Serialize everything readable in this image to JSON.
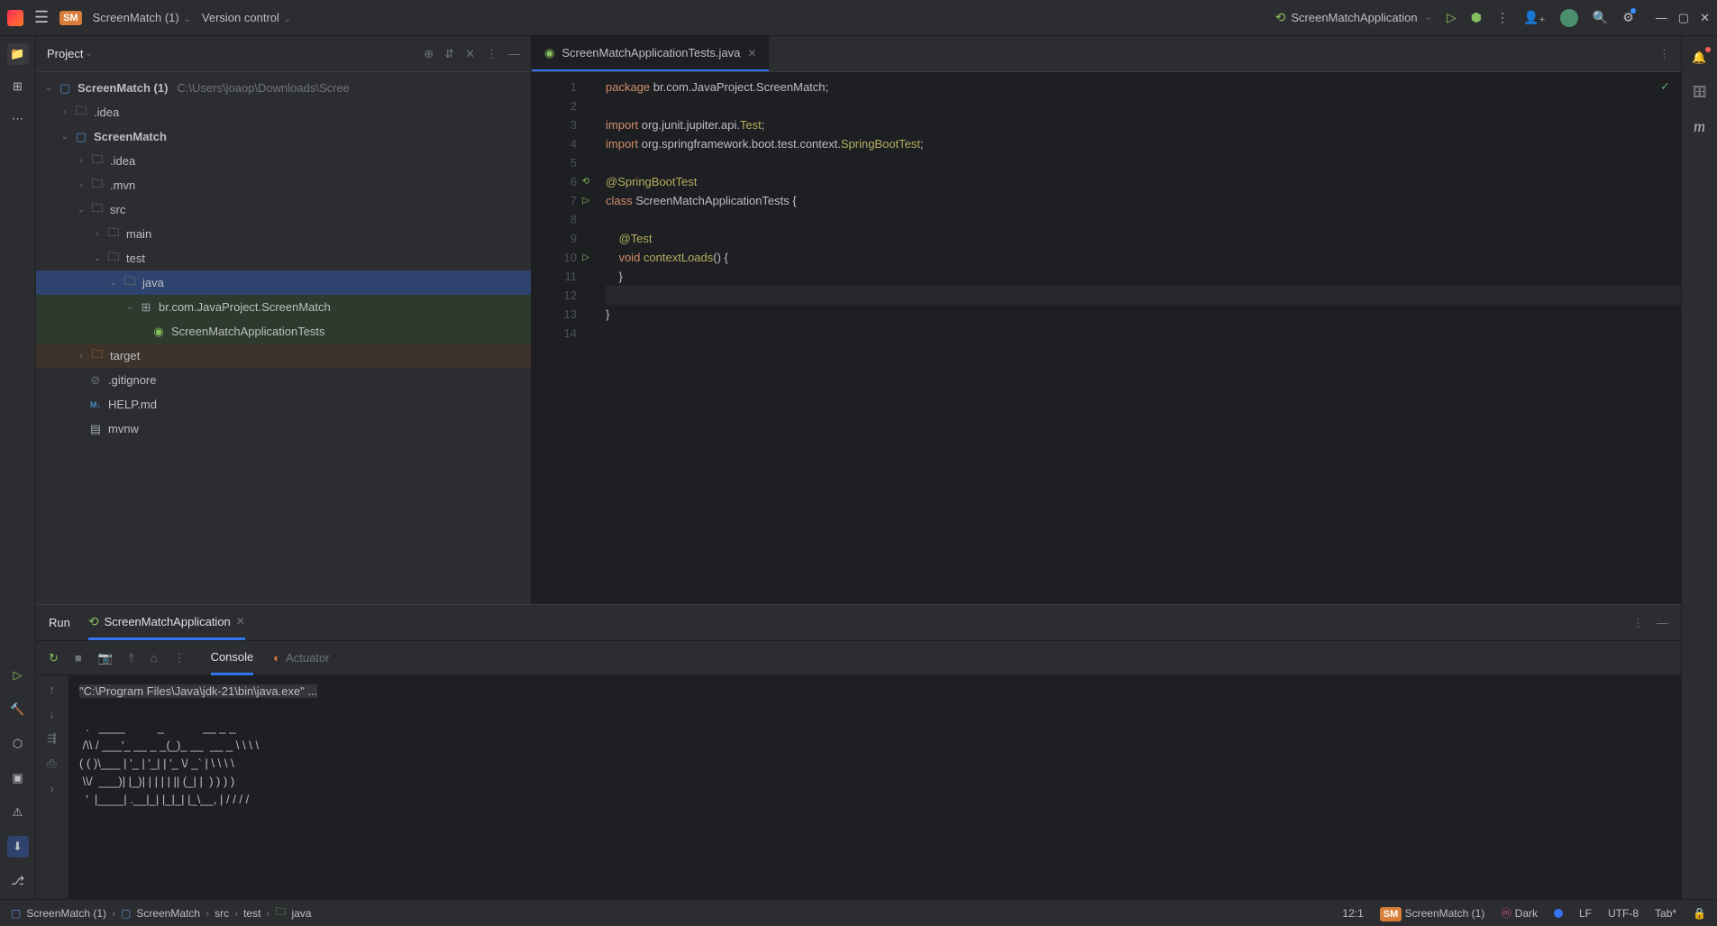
{
  "titlebar": {
    "project_badge": "SM",
    "project_name": "ScreenMatch (1)",
    "version_control": "Version control",
    "run_config": "ScreenMatchApplication"
  },
  "project_panel": {
    "title": "Project",
    "tree": {
      "root_name": "ScreenMatch (1)",
      "root_path": "C:\\Users\\joaop\\Downloads\\Scree",
      "module": "ScreenMatch",
      "idea1": ".idea",
      "idea2": ".idea",
      "mvn": ".mvn",
      "src": "src",
      "main": "main",
      "test": "test",
      "java": "java",
      "package": "br.com.JavaProject.ScreenMatch",
      "test_class": "ScreenMatchApplicationTests",
      "target": "target",
      "gitignore": ".gitignore",
      "help": "HELP.md",
      "mvnw": "mvnw"
    }
  },
  "editor": {
    "tab_name": "ScreenMatchApplicationTests.java",
    "code": {
      "l1_kw": "package",
      "l1_rest": " br.com.JavaProject.ScreenMatch;",
      "l3_kw": "import",
      "l3_mid": " org.junit.jupiter.api.",
      "l3_cls": "Test",
      "l3_end": ";",
      "l4_kw": "import",
      "l4_mid": " org.springframework.boot.test.context.",
      "l4_cls": "SpringBootTest",
      "l4_end": ";",
      "l6": "@SpringBootTest",
      "l7_kw": "class",
      "l7_rest": " ScreenMatchApplicationTests {",
      "l9": "    @Test",
      "l10_kw": "    void",
      "l10_mid": " ",
      "l10_fn": "contextLoads",
      "l10_rest": "() {",
      "l11": "    }",
      "l13": "}"
    }
  },
  "run_panel": {
    "run_label": "Run",
    "config_tab": "ScreenMatchApplication",
    "console_tab": "Console",
    "actuator_tab": "Actuator",
    "output_cmd": "\"C:\\Program Files\\Java\\jdk-21\\bin\\java.exe\" ...",
    "ascii1": "  .   ____          _            __ _ _",
    "ascii2": " /\\\\ / ___'_ __ _ _(_)_ __  __ _ \\ \\ \\ \\",
    "ascii3": "( ( )\\___ | '_ | '_| | '_ \\/ _` | \\ \\ \\ \\",
    "ascii4": " \\\\/  ___)| |_)| | | | | || (_| |  ) ) ) )",
    "ascii5": "  '  |____| .__|_| |_|_| |_\\__, | / / / /"
  },
  "breadcrumb": {
    "b1": "ScreenMatch (1)",
    "b2": "ScreenMatch",
    "b3": "src",
    "b4": "test",
    "b5": "java"
  },
  "status": {
    "cursor": "12:1",
    "badge": "SM",
    "branch": "ScreenMatch (1)",
    "theme": "Dark",
    "line_sep": "LF",
    "encoding": "UTF-8",
    "indent": "Tab*"
  }
}
